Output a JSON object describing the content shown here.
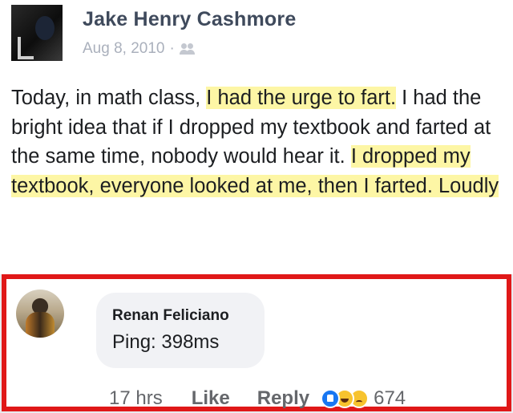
{
  "post": {
    "author": "Jake Henry Cashmore",
    "date": "Aug 8, 2010",
    "separator": "·",
    "audience_icon": "friends-icon",
    "text_segments": [
      {
        "text": "Today, in math class, ",
        "highlight": false
      },
      {
        "text": "I had the urge to fart.",
        "highlight": true
      },
      {
        "text": " I had the bright idea that if I dropped my textbook and farted at the same time, nobody would hear it. ",
        "highlight": false
      },
      {
        "text": "I dropped my textbook, everyone looked at me, then I farted. Loudly",
        "highlight": true
      }
    ]
  },
  "comment": {
    "author": "Renan Feliciano",
    "text": "Ping: 398ms",
    "time": "17 hrs",
    "like_label": "Like",
    "reply_label": "Reply",
    "reactions": [
      "like-reaction-icon",
      "haha-reaction-icon",
      "sad-reaction-icon"
    ],
    "reaction_count": "674"
  },
  "colors": {
    "highlight": "#fdf6a5",
    "frame_red": "#e01818",
    "author_blue_gray": "#3f4a5c"
  }
}
